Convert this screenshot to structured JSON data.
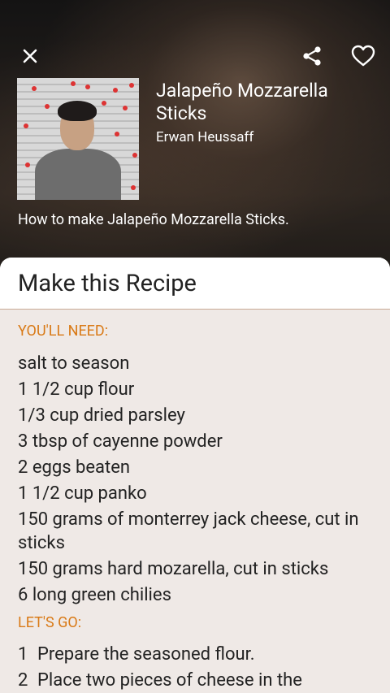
{
  "header": {
    "title": "Jalapeño Mozzarella Sticks",
    "author": "Erwan Heussaff",
    "description": "How to make Jalapeño Mozzarella Sticks."
  },
  "icons": {
    "close": "close-icon",
    "share": "share-icon",
    "favorite": "heart-icon"
  },
  "card": {
    "title": "Make this Recipe",
    "need_label": "YOU'LL NEED:",
    "ingredients": [
      "salt to season",
      "1 1/2 cup flour",
      "1/3 cup dried parsley",
      "3 tbsp of cayenne powder",
      "2 eggs beaten",
      "1 1/2 cup panko",
      "150 grams of monterrey jack cheese, cut in sticks",
      "150 grams hard mozarella, cut in sticks",
      "6 long green chilies"
    ],
    "go_label": "LET'S GO:",
    "steps": [
      {
        "num": "1",
        "text": "Prepare the seasoned flour."
      },
      {
        "num": "2",
        "text": "Place two pieces of cheese in the"
      }
    ]
  },
  "colors": {
    "accent": "#d97a17",
    "card_bg": "#efe9e6"
  }
}
